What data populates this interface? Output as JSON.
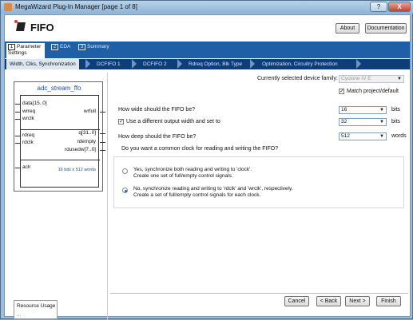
{
  "window": {
    "title": "MegaWizard Plug-In Manager [page 1 of 8]",
    "help_button": "?",
    "close_button": "X"
  },
  "header": {
    "title": "FIFO",
    "about_label": "About",
    "documentation_label": "Documentation"
  },
  "tabs": [
    {
      "num": "1",
      "label": "Parameter Settings",
      "active": true
    },
    {
      "num": "2",
      "label": "EDA",
      "active": false
    },
    {
      "num": "3",
      "label": "Summary",
      "active": false
    }
  ],
  "crumbs": [
    "Width, Clks, Synchronization",
    "DCFIFO 1",
    "DCFIFO 2",
    "Rdreq Option, Blk Type",
    "Optimization, Circuitry Protection"
  ],
  "block": {
    "title": "adc_stream_ffo",
    "pins_left": [
      "data[15..0]",
      "wrreq",
      "wrclk",
      "rdreq",
      "rdclk",
      "aclr"
    ],
    "pins_right": [
      "wrfull",
      "q[31..0]",
      "rdempty",
      "rdusedw[7..0]"
    ],
    "size_note": "16 bits x 512 words"
  },
  "resource": {
    "label": "Resource Usage",
    "value": "..."
  },
  "form": {
    "family_label": "Currently selected device family:",
    "family_value": "Cyclone IV E",
    "match_label": "Match project/default",
    "width_question": "How wide should the FIFO be?",
    "width_value": "16",
    "width_unit": "bits",
    "diff_output_label": "Use a different output width and set to",
    "output_width_value": "32",
    "output_width_unit": "bits",
    "depth_question": "How deep should the FIFO be?",
    "depth_value": "512",
    "depth_unit": "words",
    "clock_question": "Do you want a common clock for reading and writing the FIFO?",
    "opt_yes_line1": "Yes, synchronize both reading and writing to 'clock'.",
    "opt_yes_line2": "Create one set of full/empty control signals.",
    "opt_no_line1": "No, synchronize reading and writing to 'rdclk' and 'wrclk', respectively.",
    "opt_no_line2": "Create a set of full/empty control signals for each clock."
  },
  "footer": {
    "cancel": "Cancel",
    "back": "< Back",
    "next": "Next >",
    "finish": "Finish"
  }
}
